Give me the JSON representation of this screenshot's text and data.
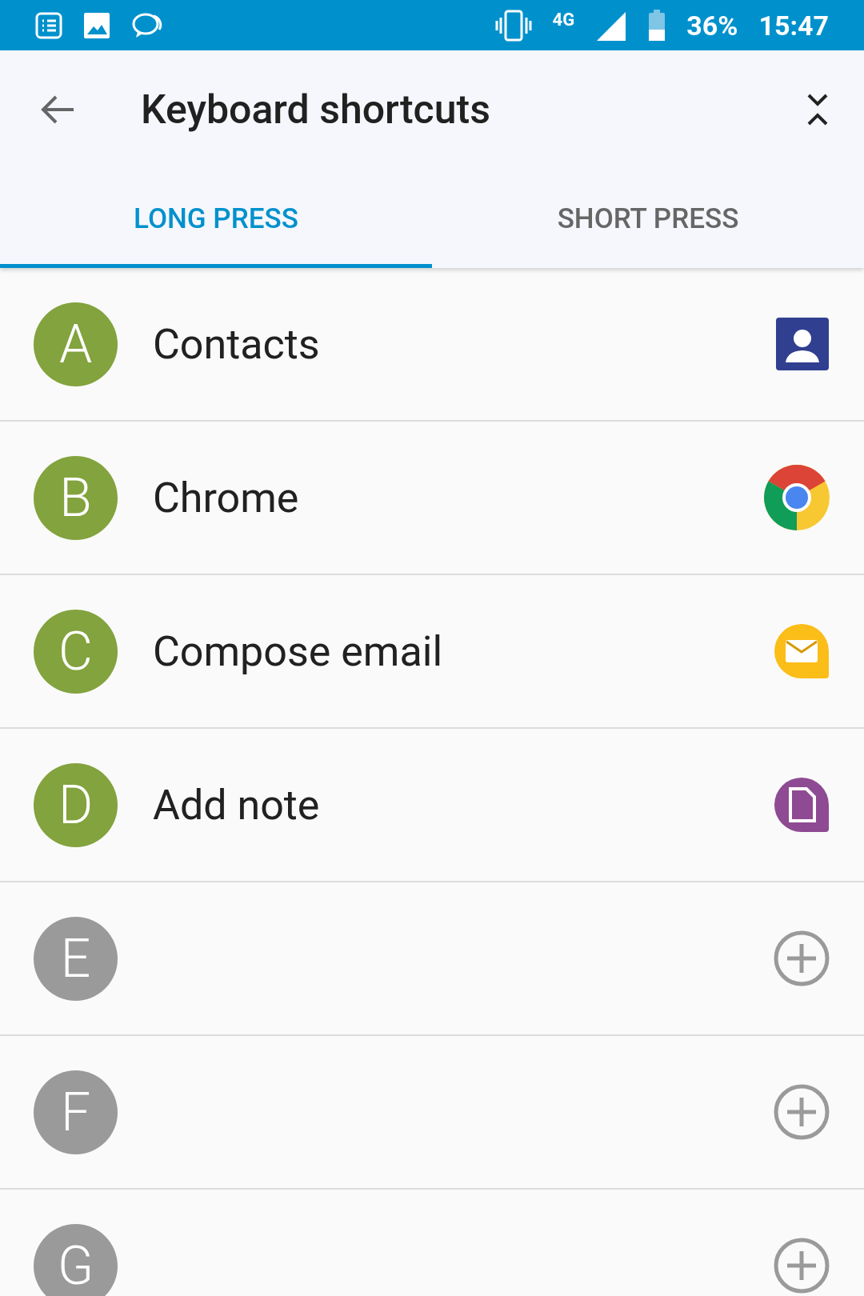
{
  "status_bar": {
    "network": "4G",
    "battery": "36%",
    "time": "15:47"
  },
  "toolbar": {
    "title": "Keyboard shortcuts"
  },
  "tabs": [
    {
      "label": "LONG PRESS",
      "selected": true
    },
    {
      "label": "SHORT PRESS",
      "selected": false
    }
  ],
  "shortcuts": [
    {
      "letter": "A",
      "name": "Contacts",
      "kind": "app"
    },
    {
      "letter": "B",
      "name": "Chrome",
      "kind": "app"
    },
    {
      "letter": "C",
      "name": "Compose email",
      "kind": "app"
    },
    {
      "letter": "D",
      "name": "Add note",
      "kind": "app"
    },
    {
      "letter": "E",
      "kind": "empty"
    },
    {
      "letter": "F",
      "kind": "empty"
    },
    {
      "letter": "G",
      "kind": "empty"
    }
  ]
}
